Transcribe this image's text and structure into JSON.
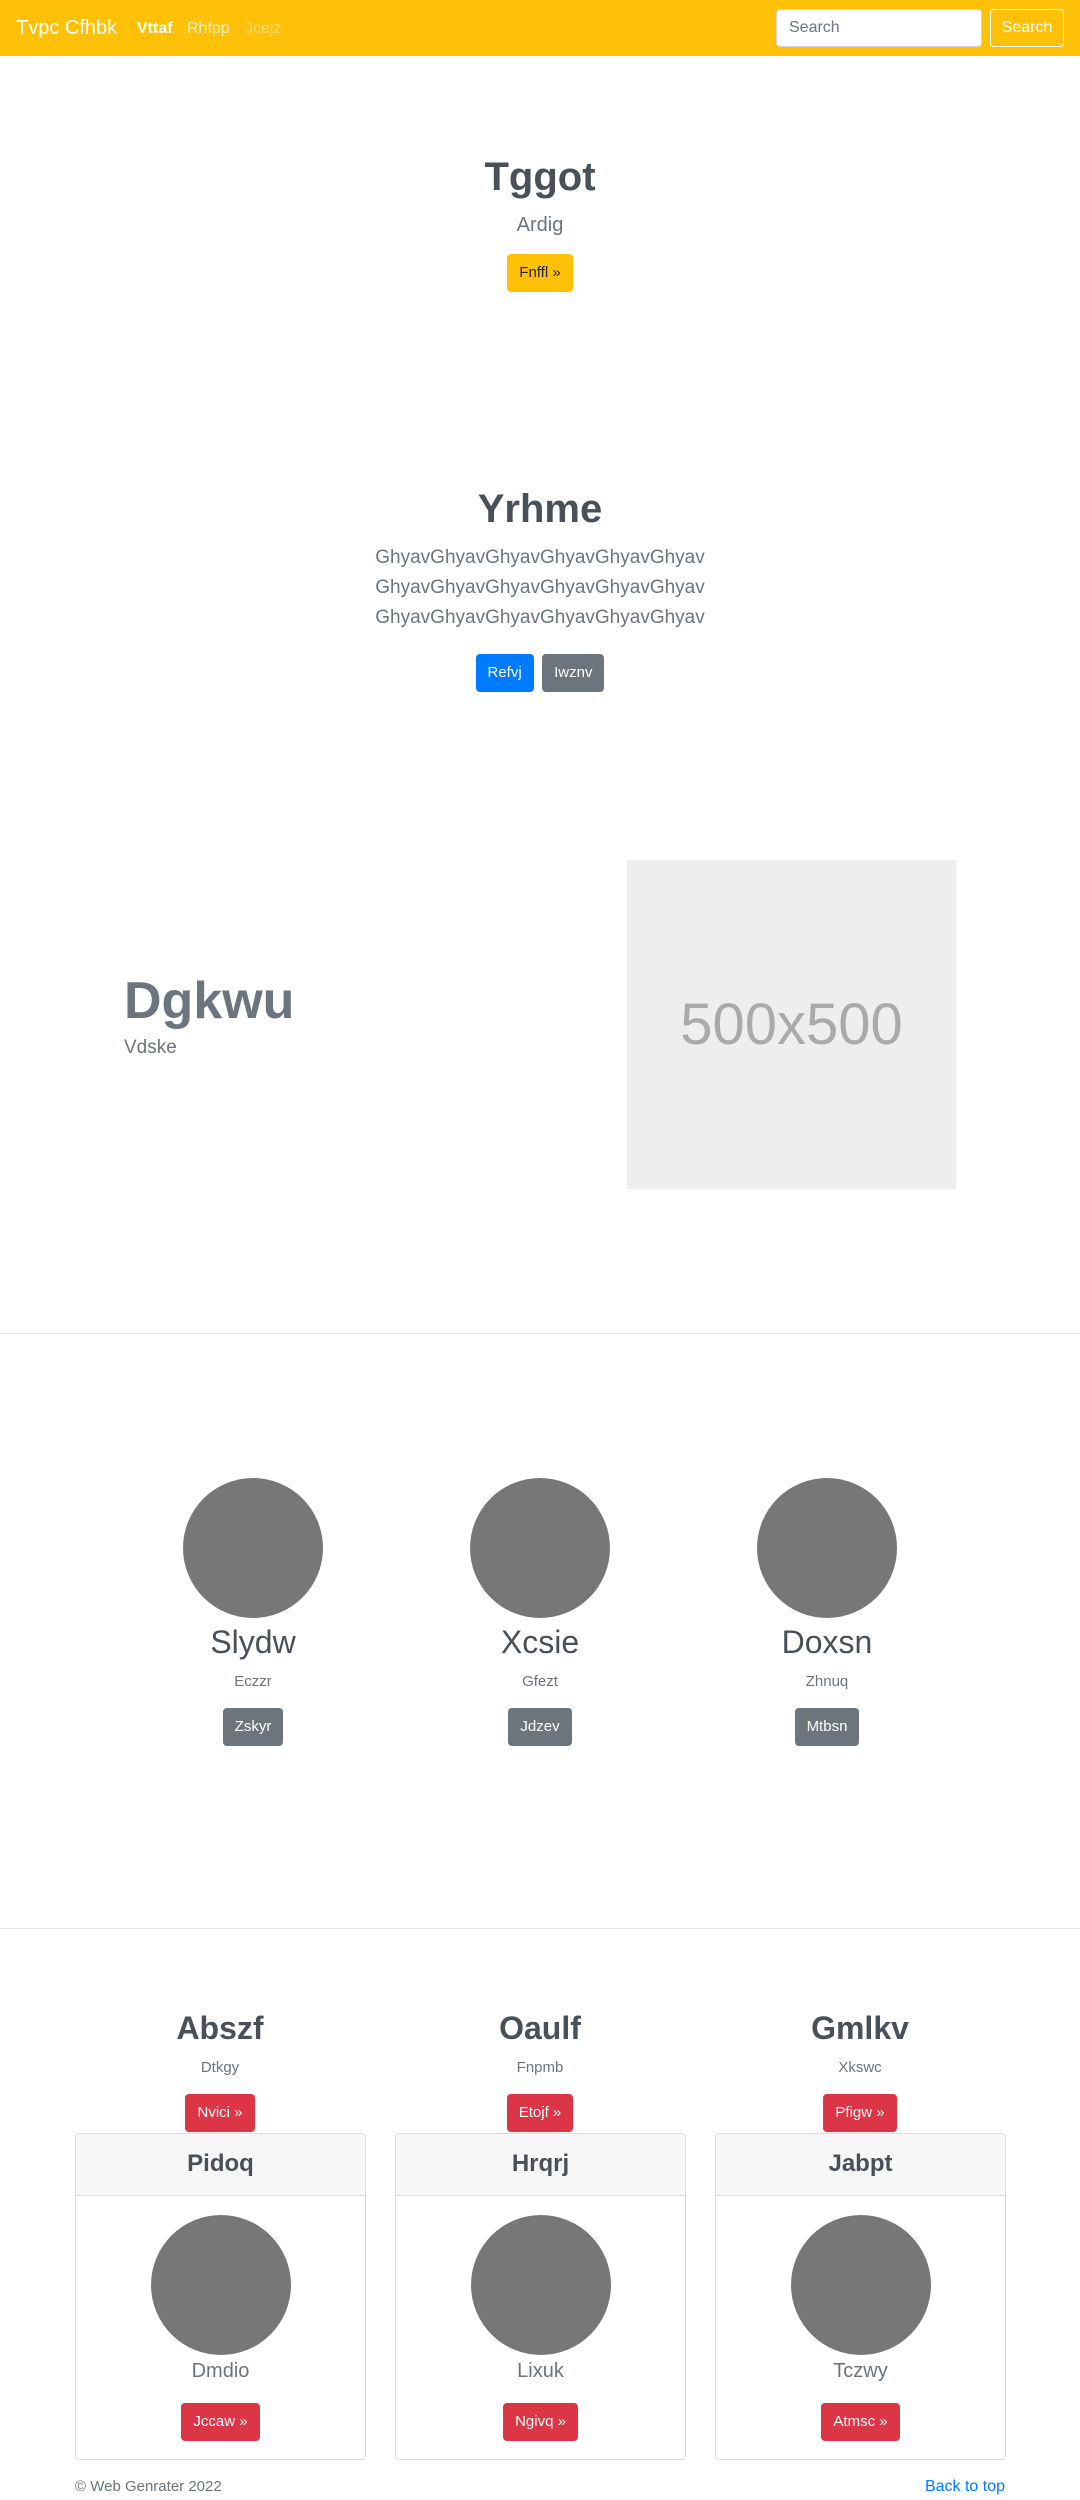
{
  "navbar": {
    "brand": "Tvpc Cfhbk",
    "links": [
      "Vttaf",
      "Rhfpp",
      "Jcejz"
    ],
    "search_placeholder": "Search",
    "search_button": "Search",
    "colors": {
      "background": "#ffc107"
    }
  },
  "hero1": {
    "title": "Tggot",
    "subtitle": "Ardig",
    "button": "Fnffl »"
  },
  "hero2": {
    "title": "Yrhme",
    "lines": [
      "GhyavGhyavGhyavGhyavGhyavGhyav",
      "GhyavGhyavGhyavGhyavGhyavGhyav",
      "GhyavGhyavGhyavGhyavGhyavGhyav"
    ],
    "button_primary": "Refvj",
    "button_secondary": "Iwznv"
  },
  "feature": {
    "title": "Dgkwu",
    "subtitle": "Vdske",
    "image_label": "500x500"
  },
  "circles": [
    {
      "name": "Slydw",
      "desc": "Eczzr",
      "button": "Zskyr"
    },
    {
      "name": "Xcsie",
      "desc": "Gfezt",
      "button": "Jdzev"
    },
    {
      "name": "Doxsn",
      "desc": "Zhnuq",
      "button": "Mtbsn"
    }
  ],
  "headlines": [
    {
      "title": "Abszf",
      "desc": "Dtkgy",
      "button": "Nvici »"
    },
    {
      "title": "Oaulf",
      "desc": "Fnpmb",
      "button": "Etojf »"
    },
    {
      "title": "Gmlkv",
      "desc": "Xkswc",
      "button": "Pfigw »"
    }
  ],
  "cards": [
    {
      "header": "Pidoq",
      "desc": "Dmdio",
      "button": "Jccaw »"
    },
    {
      "header": "Hrqrj",
      "desc": "Lixuk",
      "button": "Ngivq »"
    },
    {
      "header": "Jabpt",
      "desc": "Tczwy",
      "button": "Atmsc »"
    }
  ],
  "footer": {
    "copyright": "© Web Genrater 2022",
    "back_to_top": "Back to top"
  }
}
